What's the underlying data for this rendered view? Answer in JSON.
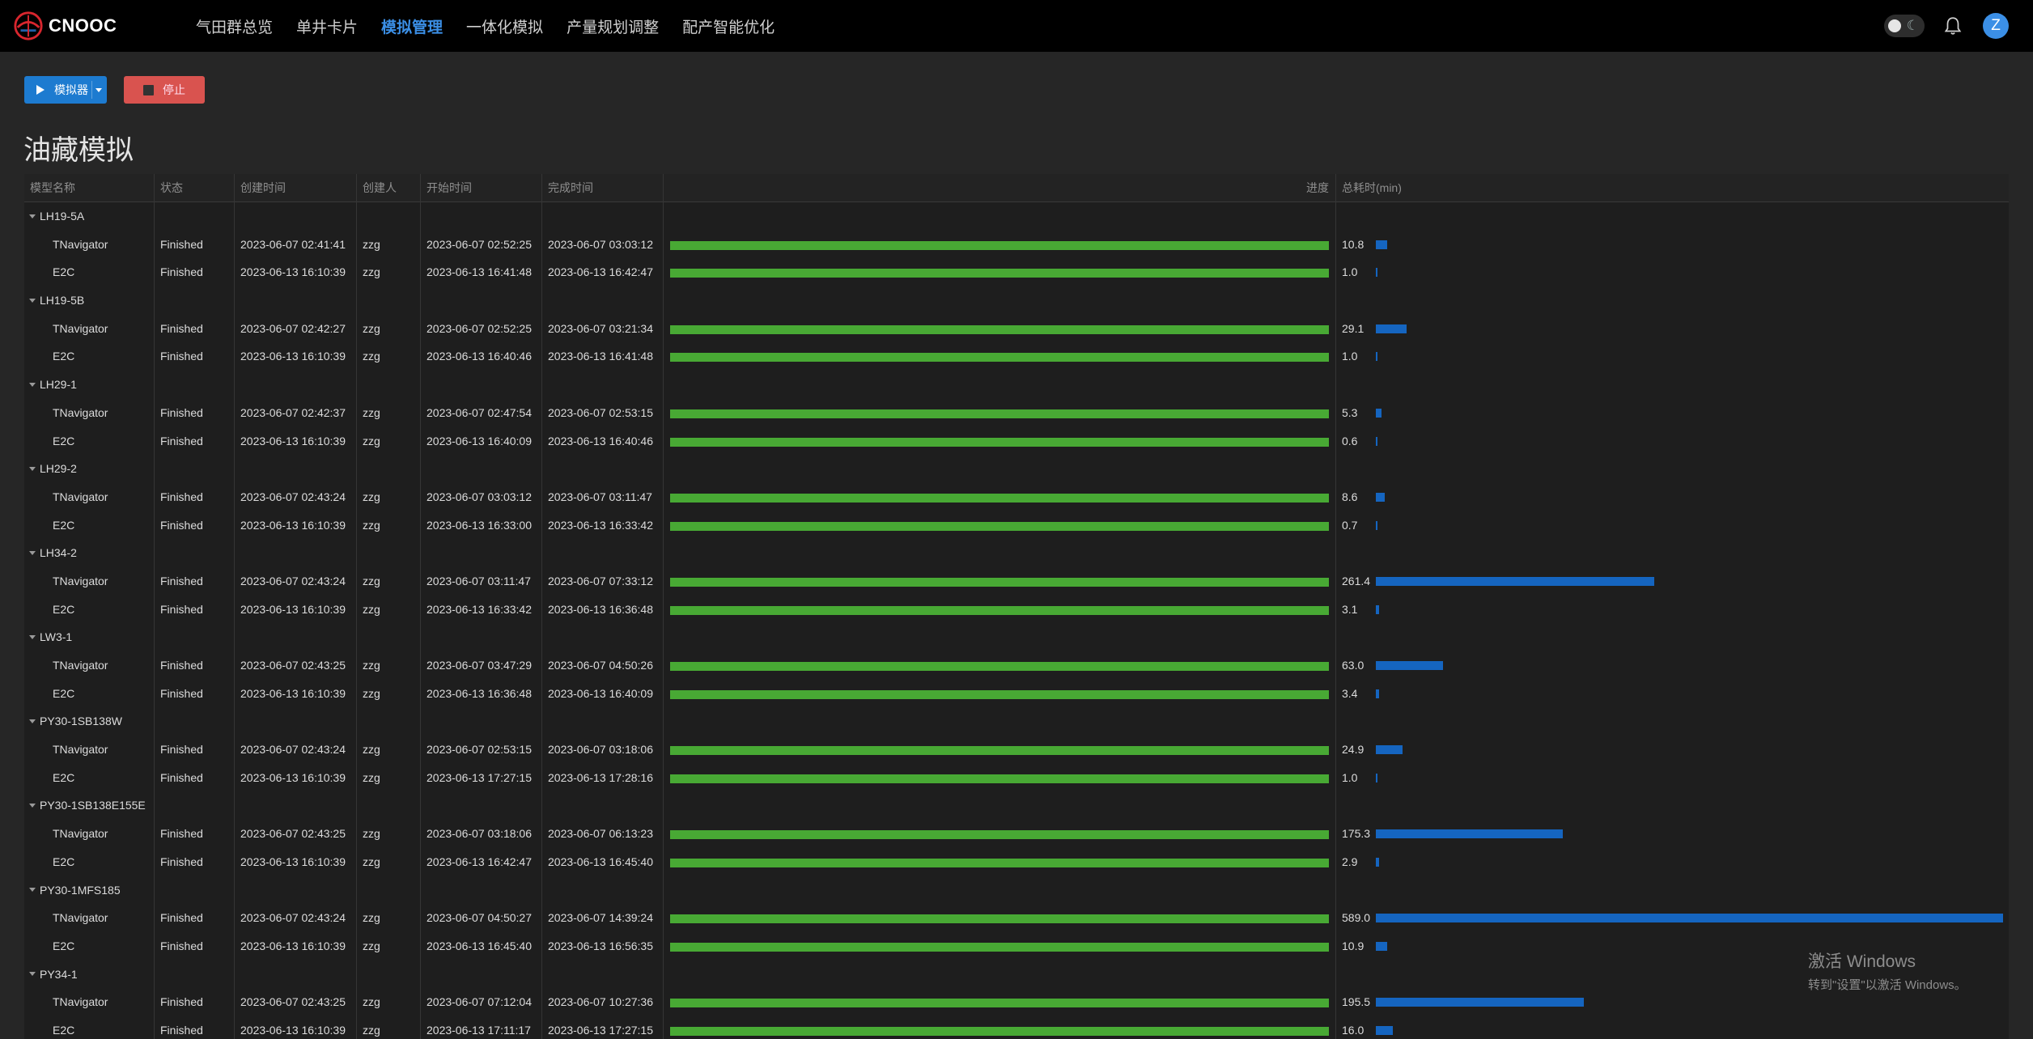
{
  "brand": {
    "name": "CNOOC"
  },
  "nav": [
    {
      "label": "气田群总览",
      "active": false
    },
    {
      "label": "单井卡片",
      "active": false
    },
    {
      "label": "模拟管理",
      "active": true
    },
    {
      "label": "一体化模拟",
      "active": false
    },
    {
      "label": "产量规划调整",
      "active": false
    },
    {
      "label": "配产智能优化",
      "active": false
    }
  ],
  "user": {
    "avatar_letter": "Z"
  },
  "toolbar": {
    "simulator_label": "模拟器",
    "stop_label": "停止"
  },
  "page": {
    "title": "油藏模拟"
  },
  "colors": {
    "accent": "#3b8fe6",
    "progress": "#48a934",
    "duration": "#1565c0",
    "stop": "#d9534f"
  },
  "table": {
    "columns": {
      "name": "模型名称",
      "status": "状态",
      "created": "创建时间",
      "creator": "创建人",
      "start": "开始时间",
      "finish": "完成时间",
      "progress": "进度",
      "duration": "总耗时(min)"
    },
    "max_duration": 589.0,
    "groups": [
      {
        "name": "LH19-5A",
        "rows": [
          {
            "name": "TNavigator",
            "status": "Finished",
            "created": "2023-06-07 02:41:41",
            "creator": "zzg",
            "start": "2023-06-07 02:52:25",
            "finish": "2023-06-07 03:03:12",
            "progress": 1.0,
            "duration": "10.8"
          },
          {
            "name": "E2C",
            "status": "Finished",
            "created": "2023-06-13 16:10:39",
            "creator": "zzg",
            "start": "2023-06-13 16:41:48",
            "finish": "2023-06-13 16:42:47",
            "progress": 1.0,
            "duration": "1.0"
          }
        ]
      },
      {
        "name": "LH19-5B",
        "rows": [
          {
            "name": "TNavigator",
            "status": "Finished",
            "created": "2023-06-07 02:42:27",
            "creator": "zzg",
            "start": "2023-06-07 02:52:25",
            "finish": "2023-06-07 03:21:34",
            "progress": 1.0,
            "duration": "29.1"
          },
          {
            "name": "E2C",
            "status": "Finished",
            "created": "2023-06-13 16:10:39",
            "creator": "zzg",
            "start": "2023-06-13 16:40:46",
            "finish": "2023-06-13 16:41:48",
            "progress": 1.0,
            "duration": "1.0"
          }
        ]
      },
      {
        "name": "LH29-1",
        "rows": [
          {
            "name": "TNavigator",
            "status": "Finished",
            "created": "2023-06-07 02:42:37",
            "creator": "zzg",
            "start": "2023-06-07 02:47:54",
            "finish": "2023-06-07 02:53:15",
            "progress": 1.0,
            "duration": "5.3"
          },
          {
            "name": "E2C",
            "status": "Finished",
            "created": "2023-06-13 16:10:39",
            "creator": "zzg",
            "start": "2023-06-13 16:40:09",
            "finish": "2023-06-13 16:40:46",
            "progress": 1.0,
            "duration": "0.6"
          }
        ]
      },
      {
        "name": "LH29-2",
        "rows": [
          {
            "name": "TNavigator",
            "status": "Finished",
            "created": "2023-06-07 02:43:24",
            "creator": "zzg",
            "start": "2023-06-07 03:03:12",
            "finish": "2023-06-07 03:11:47",
            "progress": 1.0,
            "duration": "8.6"
          },
          {
            "name": "E2C",
            "status": "Finished",
            "created": "2023-06-13 16:10:39",
            "creator": "zzg",
            "start": "2023-06-13 16:33:00",
            "finish": "2023-06-13 16:33:42",
            "progress": 1.0,
            "duration": "0.7"
          }
        ]
      },
      {
        "name": "LH34-2",
        "rows": [
          {
            "name": "TNavigator",
            "status": "Finished",
            "created": "2023-06-07 02:43:24",
            "creator": "zzg",
            "start": "2023-06-07 03:11:47",
            "finish": "2023-06-07 07:33:12",
            "progress": 1.0,
            "duration": "261.4"
          },
          {
            "name": "E2C",
            "status": "Finished",
            "created": "2023-06-13 16:10:39",
            "creator": "zzg",
            "start": "2023-06-13 16:33:42",
            "finish": "2023-06-13 16:36:48",
            "progress": 1.0,
            "duration": "3.1"
          }
        ]
      },
      {
        "name": "LW3-1",
        "rows": [
          {
            "name": "TNavigator",
            "status": "Finished",
            "created": "2023-06-07 02:43:25",
            "creator": "zzg",
            "start": "2023-06-07 03:47:29",
            "finish": "2023-06-07 04:50:26",
            "progress": 1.0,
            "duration": "63.0"
          },
          {
            "name": "E2C",
            "status": "Finished",
            "created": "2023-06-13 16:10:39",
            "creator": "zzg",
            "start": "2023-06-13 16:36:48",
            "finish": "2023-06-13 16:40:09",
            "progress": 1.0,
            "duration": "3.4"
          }
        ]
      },
      {
        "name": "PY30-1SB138W",
        "rows": [
          {
            "name": "TNavigator",
            "status": "Finished",
            "created": "2023-06-07 02:43:24",
            "creator": "zzg",
            "start": "2023-06-07 02:53:15",
            "finish": "2023-06-07 03:18:06",
            "progress": 1.0,
            "duration": "24.9"
          },
          {
            "name": "E2C",
            "status": "Finished",
            "created": "2023-06-13 16:10:39",
            "creator": "zzg",
            "start": "2023-06-13 17:27:15",
            "finish": "2023-06-13 17:28:16",
            "progress": 1.0,
            "duration": "1.0"
          }
        ]
      },
      {
        "name": "PY30-1SB138E155E",
        "rows": [
          {
            "name": "TNavigator",
            "status": "Finished",
            "created": "2023-06-07 02:43:25",
            "creator": "zzg",
            "start": "2023-06-07 03:18:06",
            "finish": "2023-06-07 06:13:23",
            "progress": 1.0,
            "duration": "175.3"
          },
          {
            "name": "E2C",
            "status": "Finished",
            "created": "2023-06-13 16:10:39",
            "creator": "zzg",
            "start": "2023-06-13 16:42:47",
            "finish": "2023-06-13 16:45:40",
            "progress": 1.0,
            "duration": "2.9"
          }
        ]
      },
      {
        "name": "PY30-1MFS185",
        "rows": [
          {
            "name": "TNavigator",
            "status": "Finished",
            "created": "2023-06-07 02:43:24",
            "creator": "zzg",
            "start": "2023-06-07 04:50:27",
            "finish": "2023-06-07 14:39:24",
            "progress": 1.0,
            "duration": "589.0"
          },
          {
            "name": "E2C",
            "status": "Finished",
            "created": "2023-06-13 16:10:39",
            "creator": "zzg",
            "start": "2023-06-13 16:45:40",
            "finish": "2023-06-13 16:56:35",
            "progress": 1.0,
            "duration": "10.9"
          }
        ]
      },
      {
        "name": "PY34-1",
        "rows": [
          {
            "name": "TNavigator",
            "status": "Finished",
            "created": "2023-06-07 02:43:25",
            "creator": "zzg",
            "start": "2023-06-07 07:12:04",
            "finish": "2023-06-07 10:27:36",
            "progress": 1.0,
            "duration": "195.5"
          },
          {
            "name": "E2C",
            "status": "Finished",
            "created": "2023-06-13 16:10:39",
            "creator": "zzg",
            "start": "2023-06-13 17:11:17",
            "finish": "2023-06-13 17:27:15",
            "progress": 1.0,
            "duration": "16.0"
          }
        ]
      }
    ]
  },
  "watermark": {
    "line1": "激活 Windows",
    "line2": "转到\"设置\"以激活 Windows。"
  }
}
